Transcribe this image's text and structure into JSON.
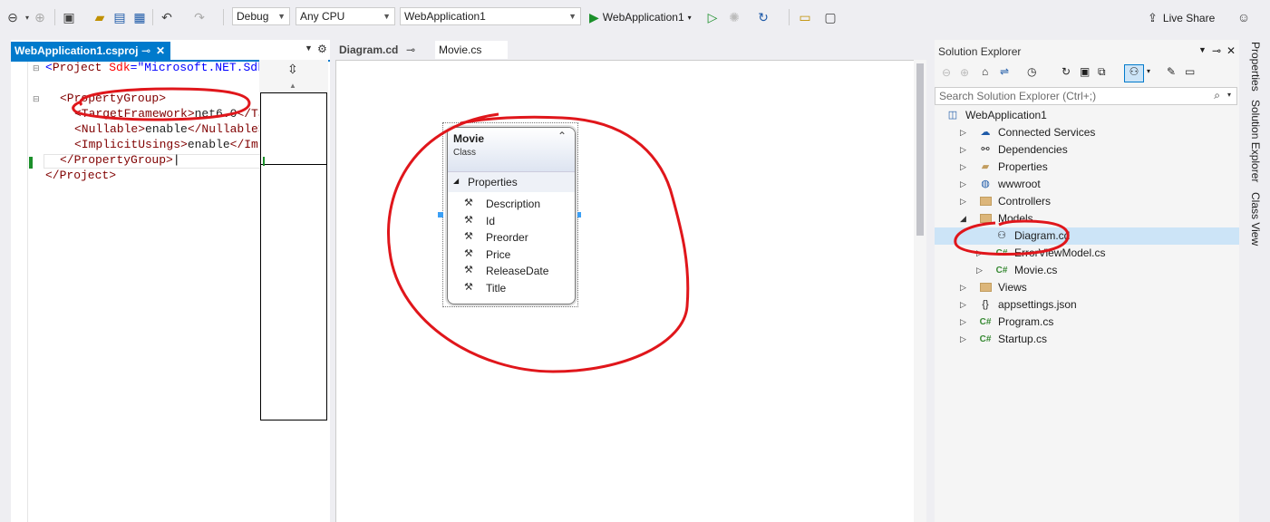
{
  "toolbar": {
    "config": "Debug",
    "platform": "Any CPU",
    "startup_project": "WebApplication1",
    "run_label": "WebApplication1",
    "live_share": "Live Share"
  },
  "left_editor": {
    "tab_title": "WebApplication1.csproj",
    "code": {
      "l1_open": "<",
      "l1_tag": "Project",
      "l1_attr": " Sdk",
      "l1_eq": "=",
      "l1_val": "\"Microsoft.NET.Sdk",
      "l3_tag": "<PropertyGroup>",
      "l4_open": "<TargetFramework>",
      "l4_val": "net6.0",
      "l4_close": "</Ta",
      "l5_open": "<Nullable>",
      "l5_val": "enable",
      "l5_close": "</Nullable>",
      "l6_open": "<ImplicitUsings>",
      "l6_val": "enable",
      "l6_close": "</Imp",
      "l7": "</PropertyGroup>",
      "l8": "</Project>"
    }
  },
  "center": {
    "tabs": [
      {
        "label": "Diagram.cd"
      },
      {
        "label": "Movie.cs"
      }
    ],
    "class_shape": {
      "name": "Movie",
      "kind": "Class",
      "section": "Properties",
      "properties": [
        "Description",
        "Id",
        "Preorder",
        "Price",
        "ReleaseDate",
        "Title"
      ]
    }
  },
  "solution_explorer": {
    "title": "Solution Explorer",
    "search_placeholder": "Search Solution Explorer (Ctrl+;)",
    "tree": [
      {
        "label": "WebApplication1"
      },
      {
        "label": "Connected Services"
      },
      {
        "label": "Dependencies"
      },
      {
        "label": "Properties"
      },
      {
        "label": "wwwroot"
      },
      {
        "label": "Controllers"
      },
      {
        "label": "Models"
      },
      {
        "label": "Diagram.cd"
      },
      {
        "label": "ErrorViewModel.cs"
      },
      {
        "label": "Movie.cs"
      },
      {
        "label": "Views"
      },
      {
        "label": "appsettings.json"
      },
      {
        "label": "Program.cs"
      },
      {
        "label": "Startup.cs"
      }
    ]
  },
  "right_strip": {
    "tabs": [
      "Properties",
      "Solution Explorer",
      "Class View"
    ]
  },
  "colors": {
    "accent": "#007acc",
    "annotation": "#e0161b",
    "selection": "#cce4f7"
  }
}
